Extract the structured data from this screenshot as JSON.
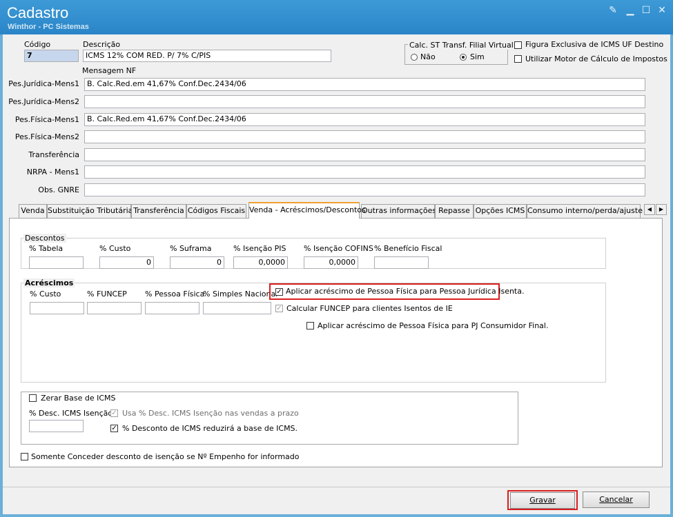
{
  "window": {
    "title": "Cadastro",
    "subtitle": "Winthor - PC Sistemas"
  },
  "fields": {
    "codigo": {
      "label": "Código",
      "value": "7"
    },
    "descricao": {
      "label": "Descrição",
      "value": "ICMS 12% COM RED. P/ 7% C/PIS"
    },
    "mensagem_nf_label": "Mensagem NF",
    "pj_mens1": {
      "label": "Pes.Jurídica-Mens1",
      "value": "B. Calc.Red.em 41,67% Conf.Dec.2434/06"
    },
    "pj_mens2": {
      "label": "Pes.Jurídica-Mens2",
      "value": ""
    },
    "pf_mens1": {
      "label": "Pes.Física-Mens1",
      "value": "B. Calc.Red.em 41,67% Conf.Dec.2434/06"
    },
    "pf_mens2": {
      "label": "Pes.Física-Mens2",
      "value": ""
    },
    "transferencia": {
      "label": "Transferência",
      "value": ""
    },
    "nrpa_mens1": {
      "label": "NRPA - Mens1",
      "value": ""
    },
    "obs_gnre": {
      "label": "Obs. GNRE",
      "value": ""
    }
  },
  "calc_st": {
    "title": "Calc. ST Transf. Filial Virtual",
    "options": [
      "Não",
      "Sim"
    ],
    "selected": "Sim"
  },
  "top_checks": {
    "figura_exclusiva": {
      "label": "Figura Exclusiva de ICMS UF Destino",
      "checked": false
    },
    "motor_calculo": {
      "label": "Utilizar Motor de Cálculo de Impostos",
      "checked": false
    }
  },
  "tabs": [
    {
      "label": "Venda",
      "active": false
    },
    {
      "label": "Substituição Tributária",
      "active": false
    },
    {
      "label": "Transferência",
      "active": false
    },
    {
      "label": "Códigos Fiscais",
      "active": false
    },
    {
      "label": "Venda - Acréscimos/Descontos",
      "active": true
    },
    {
      "label": "Outras informações",
      "active": false
    },
    {
      "label": "Repasse",
      "active": false
    },
    {
      "label": "Opções ICMS",
      "active": false
    },
    {
      "label": "Consumo interno/perda/ajuste",
      "active": false
    }
  ],
  "descontos": {
    "title": "Descontos",
    "fields": [
      {
        "label": "% Tabela",
        "value": ""
      },
      {
        "label": "% Custo",
        "value": "0"
      },
      {
        "label": "% Suframa",
        "value": "0"
      },
      {
        "label": "% Isenção PIS",
        "value": "0,0000"
      },
      {
        "label": "% Isenção COFINS",
        "value": "0,0000"
      },
      {
        "label": "% Benefício Fiscal",
        "value": ""
      }
    ]
  },
  "acrescimos": {
    "title": "Acréscimos",
    "fields": [
      {
        "label": "% Custo",
        "value": ""
      },
      {
        "label": "% FUNCEP",
        "value": ""
      },
      {
        "label": "% Pessoa Física",
        "value": ""
      },
      {
        "label": "% Simples Nacional",
        "value": ""
      }
    ],
    "checks": [
      {
        "label": "Aplicar acréscimo de Pessoa Física para Pessoa Jurídica Isenta.",
        "checked": true,
        "enabled": true
      },
      {
        "label": "Calcular FUNCEP para clientes Isentos de IE",
        "checked": true,
        "enabled": false
      },
      {
        "label": "Aplicar acréscimo de Pessoa Física para PJ Consumidor Final.",
        "checked": false,
        "enabled": true
      }
    ]
  },
  "zerar_base": {
    "label": "Zerar Base de ICMS",
    "checked": false,
    "desc_label": "% Desc. ICMS Isenção",
    "desc_value": "",
    "usa_prazo": {
      "label": "Usa % Desc. ICMS Isenção nas vendas a prazo",
      "checked": true,
      "enabled": false
    },
    "reduzira_base": {
      "label": "% Desconto de ICMS reduzirá a base de ICMS.",
      "checked": true,
      "enabled": true
    }
  },
  "somente_conceder": {
    "label": "Somente Conceder desconto de isenção se Nº Empenho for informado",
    "checked": false
  },
  "buttons": {
    "gravar": "Gravar",
    "cancelar": "Cancelar"
  },
  "colors": {
    "titlebar": "#2a85c8",
    "highlight": "#d81e1e",
    "active_tab_accent": "#f0a030"
  }
}
